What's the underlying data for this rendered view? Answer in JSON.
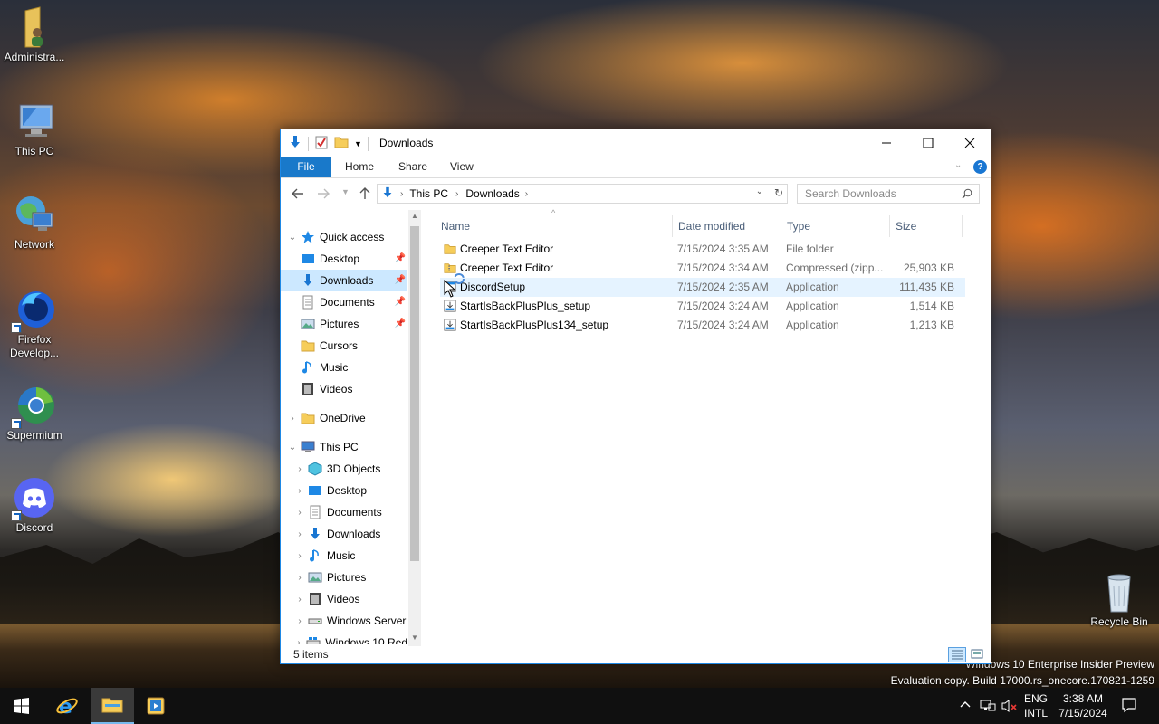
{
  "desktop": {
    "icons": [
      {
        "label": "Administra..."
      },
      {
        "label": "This PC"
      },
      {
        "label": "Network"
      },
      {
        "label": "Firefox\nDevelop..."
      },
      {
        "label": "Supermium"
      },
      {
        "label": "Discord"
      },
      {
        "label": "Recycle Bin"
      }
    ],
    "watermark_line1": "Windows 10 Enterprise Insider Preview",
    "watermark_line2": "Evaluation copy. Build 17000.rs_onecore.170821-1259"
  },
  "window": {
    "title": "Downloads",
    "tabs": {
      "file": "File",
      "home": "Home",
      "share": "Share",
      "view": "View"
    },
    "address": {
      "seg1": "This PC",
      "seg2": "Downloads"
    },
    "search_placeholder": "Search Downloads",
    "nav": {
      "quick_access": "Quick access",
      "qa_desktop": "Desktop",
      "qa_downloads": "Downloads",
      "qa_documents": "Documents",
      "qa_pictures": "Pictures",
      "qa_cursors": "Cursors",
      "qa_music": "Music",
      "qa_videos": "Videos",
      "onedrive": "OneDrive",
      "this_pc": "This PC",
      "pc_3d": "3D Objects",
      "pc_desktop": "Desktop",
      "pc_documents": "Documents",
      "pc_downloads": "Downloads",
      "pc_music": "Music",
      "pc_pictures": "Pictures",
      "pc_videos": "Videos",
      "pc_winserver": "Windows Server",
      "pc_win10": "Windows 10 Red"
    },
    "columns": {
      "name": "Name",
      "date": "Date modified",
      "type": "Type",
      "size": "Size"
    },
    "files": [
      {
        "name": "Creeper Text Editor",
        "date": "7/15/2024 3:35 AM",
        "type": "File folder",
        "size": ""
      },
      {
        "name": "Creeper Text Editor",
        "date": "7/15/2024 3:34 AM",
        "type": "Compressed (zipp...",
        "size": "25,903 KB"
      },
      {
        "name": "DiscordSetup",
        "date": "7/15/2024 2:35 AM",
        "type": "Application",
        "size": "111,435 KB"
      },
      {
        "name": "StartIsBackPlusPlus_setup",
        "date": "7/15/2024 3:24 AM",
        "type": "Application",
        "size": "1,514 KB"
      },
      {
        "name": "StartIsBackPlusPlus134_setup",
        "date": "7/15/2024 3:24 AM",
        "type": "Application",
        "size": "1,213 KB"
      }
    ],
    "status": "5 items"
  },
  "taskbar": {
    "lang1": "ENG",
    "lang2": "INTL",
    "time": "3:38 AM",
    "date": "7/15/2024"
  },
  "colors": {
    "accent": "#1979ca",
    "selection": "#cce8ff",
    "hover": "#e5f3ff"
  }
}
